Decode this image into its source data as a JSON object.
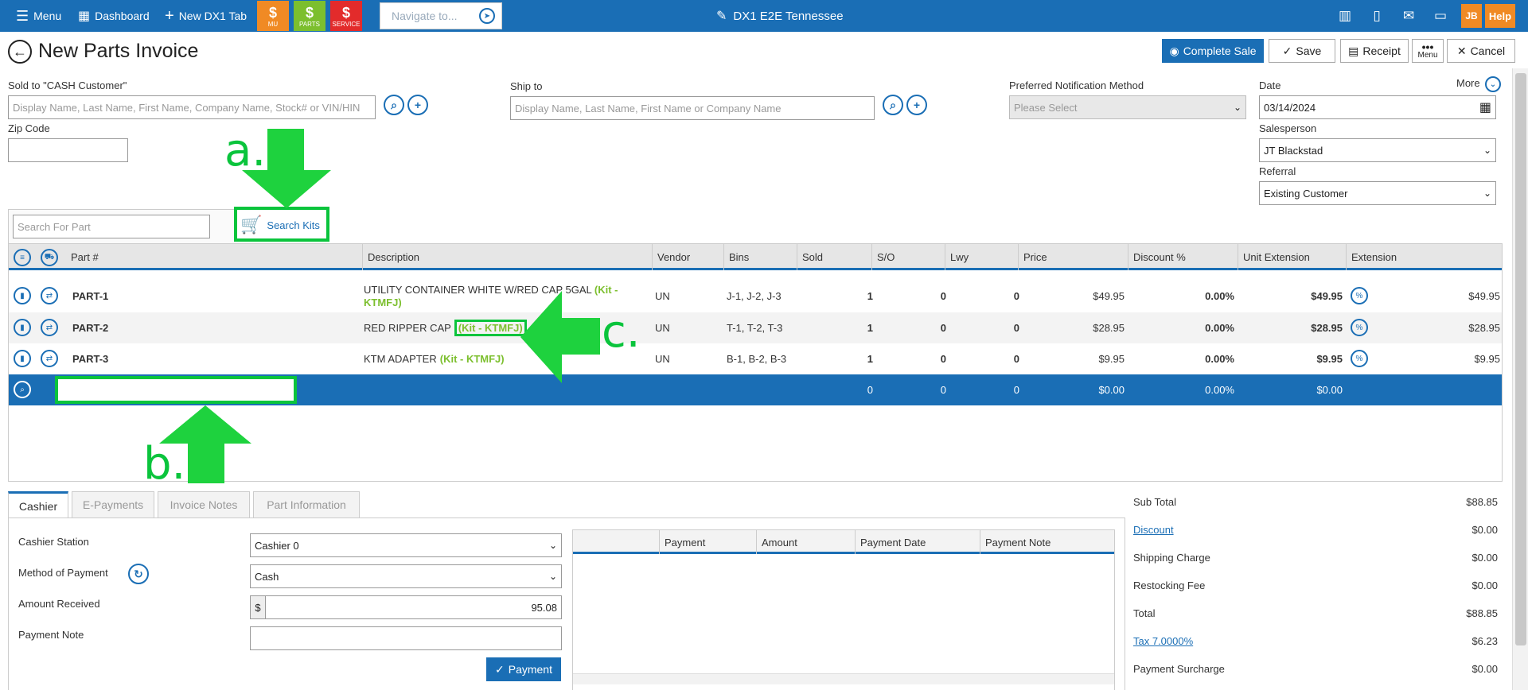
{
  "topbar": {
    "menu_label": "Menu",
    "dashboard_label": "Dashboard",
    "new_tab_label": "New DX1 Tab",
    "tiles": [
      {
        "label": "MU",
        "color": "#f08a24",
        "glyph": "$"
      },
      {
        "label": "PARTS",
        "color": "#7cbf2e",
        "glyph": "$"
      },
      {
        "label": "SERVICE",
        "color": "#e32b2b",
        "glyph": "$"
      }
    ],
    "navigate_placeholder": "Navigate to...",
    "dealer_name": "DX1 E2E Tennessee",
    "user_initials": "JB",
    "help_label": "Help"
  },
  "header": {
    "title": "New Parts Invoice",
    "complete_sale": "Complete Sale",
    "save": "Save",
    "receipt": "Receipt",
    "menu": "Menu",
    "cancel": "Cancel"
  },
  "form": {
    "sold_to_label": "Sold to  \"CASH Customer\"",
    "sold_to_placeholder": "Display Name, Last Name, First Name, Company Name, Stock# or VIN/HIN",
    "zip_label": "Zip Code",
    "ship_to_label": "Ship to",
    "ship_to_placeholder": "Display Name, Last Name, First Name or Company Name",
    "notification_label": "Preferred Notification Method",
    "notification_value": "Please Select",
    "more_label": "More",
    "date_label": "Date",
    "date_value": "03/14/2024",
    "salesperson_label": "Salesperson",
    "salesperson_value": "JT Blackstad",
    "referral_label": "Referral",
    "referral_value": "Existing Customer"
  },
  "search": {
    "part_placeholder": "Search For Part",
    "kits_label": "Search Kits"
  },
  "annotations": {
    "a": "a.",
    "b": "b.",
    "c": "c."
  },
  "grid": {
    "columns": [
      "Part #",
      "Description",
      "Vendor",
      "Bins",
      "Sold",
      "S/O",
      "Lwy",
      "Price",
      "Discount %",
      "Unit Extension",
      "Extension"
    ],
    "rows": [
      {
        "part": "PART-1",
        "desc": "UTILITY CONTAINER WHITE W/RED CAP 5GAL",
        "kit": "(Kit - KTMFJ)",
        "vendor": "UN",
        "bins": "J-1, J-2, J-3",
        "sold": "1",
        "so": "0",
        "lwy": "0",
        "price": "$49.95",
        "discount": "0.00%",
        "unit_ext": "$49.95",
        "ext": "$49.95"
      },
      {
        "part": "PART-2",
        "desc": "RED RIPPER CAP",
        "kit": "(Kit - KTMFJ)",
        "vendor": "UN",
        "bins": "T-1, T-2, T-3",
        "sold": "1",
        "so": "0",
        "lwy": "0",
        "price": "$28.95",
        "discount": "0.00%",
        "unit_ext": "$28.95",
        "ext": "$28.95"
      },
      {
        "part": "PART-3",
        "desc": "KTM ADAPTER",
        "kit": "(Kit - KTMFJ)",
        "vendor": "UN",
        "bins": "B-1, B-2, B-3",
        "sold": "1",
        "so": "0",
        "lwy": "0",
        "price": "$9.95",
        "discount": "0.00%",
        "unit_ext": "$9.95",
        "ext": "$9.95"
      }
    ],
    "entry_row": {
      "sold": "0",
      "so": "0",
      "lwy": "0",
      "price": "$0.00",
      "discount": "0.00%",
      "unit_ext": "$0.00"
    },
    "tax_icon": "%"
  },
  "tabs": [
    "Cashier",
    "E-Payments",
    "Invoice Notes",
    "Part Information"
  ],
  "cashier": {
    "station_label": "Cashier Station",
    "station_value": "Cashier 0",
    "method_label": "Method of Payment",
    "method_value": "Cash",
    "amount_label": "Amount Received",
    "currency": "$",
    "amount_value": "95.08",
    "note_label": "Payment Note",
    "payment_button": "Payment",
    "payment_columns": [
      "Payment",
      "Amount",
      "Payment Date",
      "Payment Note"
    ]
  },
  "summary": {
    "subtotal_label": "Sub Total",
    "subtotal": "$88.85",
    "discount_label": "Discount",
    "discount": "$0.00",
    "shipping_label": "Shipping Charge",
    "shipping": "$0.00",
    "restocking_label": "Restocking Fee",
    "restocking": "$0.00",
    "total_label": "Total",
    "total": "$88.85",
    "tax_label": "Tax 7.0000%",
    "tax": "$6.23",
    "surcharge_label": "Payment Surcharge",
    "surcharge": "$0.00"
  },
  "colors": {
    "brand": "#1a6eb5",
    "annotation": "#0ac43c",
    "kit": "#7cbf2e",
    "orange": "#f08a24"
  }
}
